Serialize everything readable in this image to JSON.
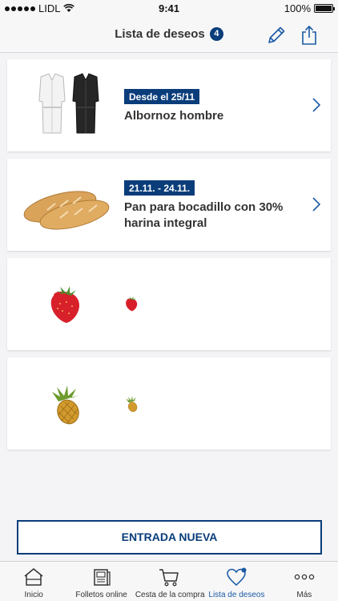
{
  "status_bar": {
    "carrier": "LIDL",
    "time": "9:41",
    "battery_text": "100%",
    "battery_level": 1.0
  },
  "nav": {
    "title": "Lista de deseos",
    "badge_count": "4",
    "edit_icon": "pencil-icon",
    "share_icon": "share-icon"
  },
  "items": [
    {
      "tag": "Desde el 25/11",
      "name": "Albornoz hombre",
      "image": "bathrobes-image"
    },
    {
      "tag": "21.11. - 24.11.",
      "name": "Pan para bocadillo con 30% harina integral",
      "image": "baguettes-image"
    },
    {
      "image": "strawberry-image"
    },
    {
      "image": "pineapple-image"
    }
  ],
  "new_entry_button": "ENTRADA NUEVA",
  "tabs": [
    {
      "label": "Inicio",
      "icon": "home-icon"
    },
    {
      "label": "Folletos online",
      "icon": "leaflet-icon"
    },
    {
      "label": "Cesta de la compra",
      "icon": "cart-icon"
    },
    {
      "label": "Lista de deseos",
      "icon": "heart-icon",
      "active": true
    },
    {
      "label": "Más",
      "icon": "more-icon"
    }
  ],
  "colors": {
    "brand_blue": "#0a3d7a",
    "active_tab": "#1a5aa6",
    "background": "#f4f4f6"
  }
}
